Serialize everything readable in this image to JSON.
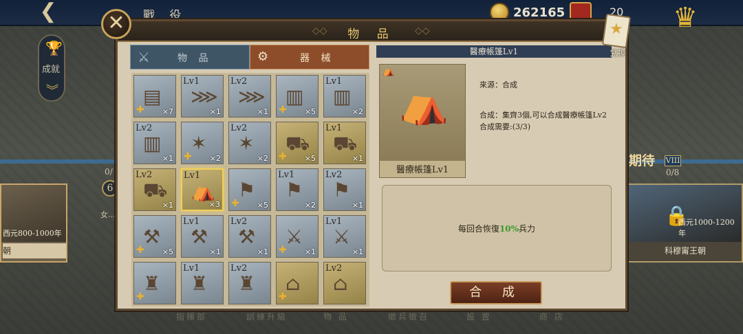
{
  "header": {
    "back_icon": "back-arrow-icon",
    "title": "戰 役",
    "gold_amount": "262165",
    "second_amount": "20"
  },
  "sidebar": {
    "achievement_label": "成就"
  },
  "eras": {
    "left": {
      "years": "西元800-1000年",
      "name": "朝",
      "progress": "0/",
      "badge": "6",
      "sub": "女..."
    },
    "right": {
      "title": "期待",
      "badge": "VIII",
      "progress": "0/8",
      "years": "西元1000-1200年",
      "name": "科穆甯王朝"
    }
  },
  "bottom_labels": [
    "指揮部",
    "訓練升級",
    "物 品",
    "徵兵徵召",
    "設 置",
    "商 店"
  ],
  "modal": {
    "title": "物 品",
    "close_icon": "close-x-icon",
    "exchange_label": "兌換",
    "tabs": [
      {
        "label": "物 品",
        "icon": "crossed-swords-icon",
        "active": false
      },
      {
        "label": "器 械",
        "icon": "catapult-icon",
        "active": true
      }
    ],
    "grid": [
      {
        "lv": "",
        "count": "×7",
        "puzzle": true,
        "art": "barricade",
        "bg": "blue"
      },
      {
        "lv": "Lv1",
        "count": "×1",
        "puzzle": false,
        "art": "spiked-barrier",
        "bg": "blue"
      },
      {
        "lv": "Lv2",
        "count": "×1",
        "puzzle": false,
        "art": "spiked-barrier",
        "bg": "blue"
      },
      {
        "lv": "",
        "count": "×5",
        "puzzle": true,
        "art": "tower",
        "bg": "blue"
      },
      {
        "lv": "Lv1",
        "count": "×2",
        "puzzle": false,
        "art": "tower",
        "bg": "blue"
      },
      {
        "lv": "Lv2",
        "count": "×1",
        "puzzle": false,
        "art": "tower",
        "bg": "blue"
      },
      {
        "lv": "",
        "count": "×2",
        "puzzle": true,
        "art": "caltrops",
        "bg": "blue"
      },
      {
        "lv": "Lv2",
        "count": "×2",
        "puzzle": false,
        "art": "caltrops",
        "bg": "blue"
      },
      {
        "lv": "",
        "count": "×5",
        "puzzle": true,
        "art": "wagon",
        "bg": "gold"
      },
      {
        "lv": "Lv1",
        "count": "×1",
        "puzzle": false,
        "art": "wagon",
        "bg": "gold"
      },
      {
        "lv": "Lv2",
        "count": "×1",
        "puzzle": false,
        "art": "wagon",
        "bg": "gold"
      },
      {
        "lv": "Lv1",
        "count": "×3",
        "puzzle": false,
        "art": "tent",
        "bg": "gold",
        "selected": true
      },
      {
        "lv": "",
        "count": "×5",
        "puzzle": true,
        "art": "banner-cart",
        "bg": "blue"
      },
      {
        "lv": "Lv1",
        "count": "×2",
        "puzzle": false,
        "art": "banner-cart",
        "bg": "blue"
      },
      {
        "lv": "Lv2",
        "count": "×1",
        "puzzle": false,
        "art": "banner-cart",
        "bg": "blue"
      },
      {
        "lv": "",
        "count": "×5",
        "puzzle": true,
        "art": "catapult",
        "bg": "blue"
      },
      {
        "lv": "Lv1",
        "count": "×1",
        "puzzle": false,
        "art": "catapult",
        "bg": "blue"
      },
      {
        "lv": "Lv2",
        "count": "×1",
        "puzzle": false,
        "art": "catapult",
        "bg": "blue"
      },
      {
        "lv": "",
        "count": "×1",
        "puzzle": true,
        "art": "ballista",
        "bg": "blue"
      },
      {
        "lv": "Lv1",
        "count": "×1",
        "puzzle": false,
        "art": "ballista",
        "bg": "blue"
      },
      {
        "lv": "",
        "count": "",
        "puzzle": true,
        "art": "trebuchet",
        "bg": "blue"
      },
      {
        "lv": "Lv1",
        "count": "",
        "puzzle": false,
        "art": "trebuchet",
        "bg": "blue"
      },
      {
        "lv": "Lv2",
        "count": "",
        "puzzle": false,
        "art": "trebuchet",
        "bg": "blue"
      },
      {
        "lv": "",
        "count": "",
        "puzzle": true,
        "art": "roofed-ram",
        "bg": "gold"
      },
      {
        "lv": "Lv2",
        "count": "",
        "puzzle": false,
        "art": "roofed-ram",
        "bg": "gold"
      }
    ],
    "detail": {
      "title": "醫療帳篷Lv1",
      "image_name": "醫療帳篷Lv1",
      "source": "來源：合成",
      "synth": "合成：集齊3個,可以合成醫療帳篷Lv2",
      "need": "合成需要:(3/3)",
      "effect_prefix": "每回合恢復",
      "effect_value": "10%",
      "effect_suffix": "兵力",
      "craft_label": "合 成"
    }
  }
}
